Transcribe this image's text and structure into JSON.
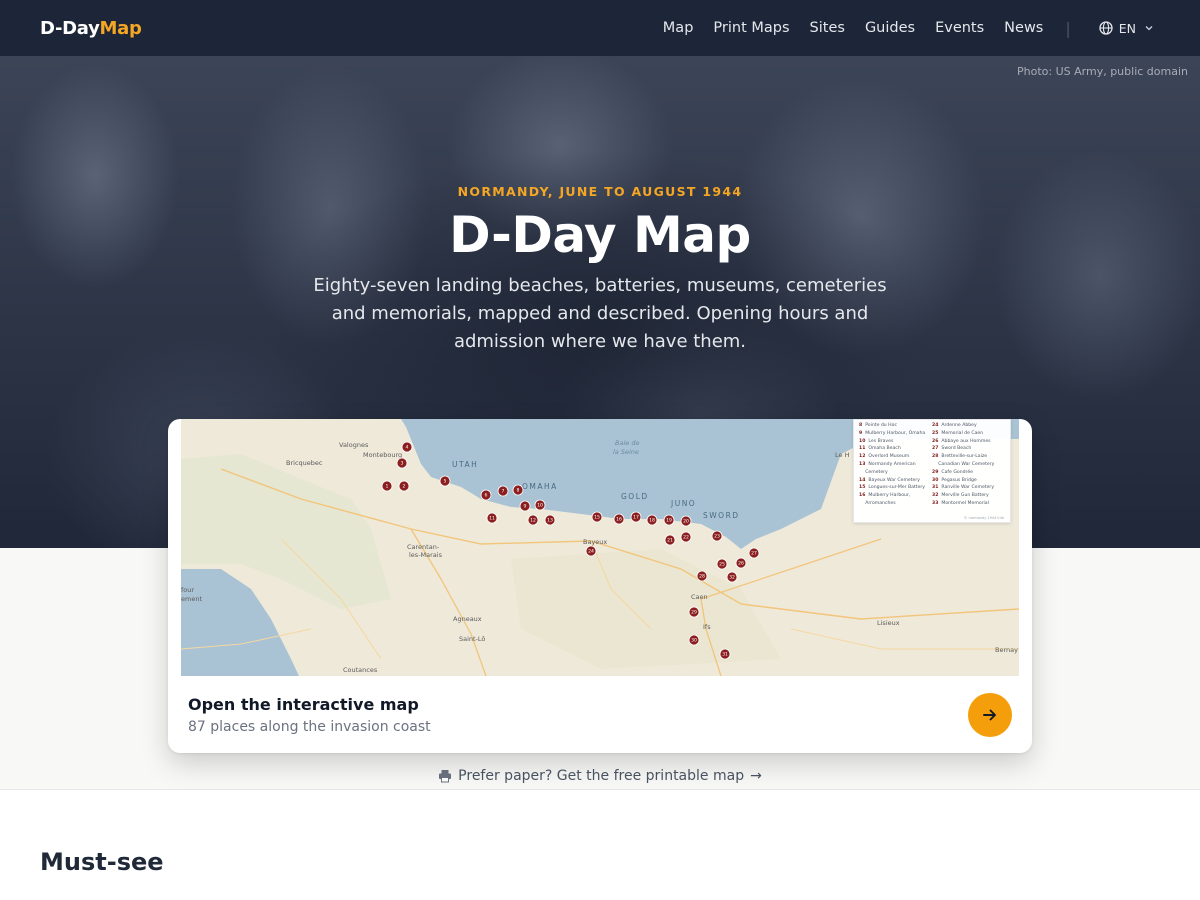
{
  "nav": {
    "logo_part1": "D-Day",
    "logo_part2": "Map",
    "links": [
      "Map",
      "Print Maps",
      "Sites",
      "Guides",
      "Events",
      "News"
    ],
    "separator": "|",
    "lang": "EN",
    "lang_icon": "globe-icon",
    "lang_chevron": "chevron-down-icon"
  },
  "hero": {
    "credit": "Photo: US Army, public domain",
    "eyebrow": "NORMANDY, JUNE TO AUGUST 1944",
    "title": "D-Day Map",
    "subtitle": "Eighty-seven landing beaches, batteries, museums, cemeteries and memorials, mapped and described. Opening hours and admission where we have them."
  },
  "map": {
    "places": [
      "Valognes",
      "Bricquebec",
      "Montebourg",
      "Carentan-les-Marais",
      "Bayeux",
      "Caen",
      "Ifs",
      "Lisieux",
      "Bernay",
      "Agneaux",
      "Saint-Lô",
      "Coutances",
      "Le H",
      "Baie de la Seine"
    ],
    "sea_labels": [
      "UTAH",
      "OMAHA",
      "GOLD",
      "JUNO",
      "SWORD"
    ],
    "markers": [
      "1",
      "2",
      "3",
      "4",
      "5",
      "6",
      "7",
      "8",
      "9",
      "10",
      "11",
      "12",
      "13",
      "15",
      "16",
      "17",
      "18",
      "19",
      "20",
      "21",
      "22",
      "23",
      "24",
      "25",
      "26",
      "27",
      "28",
      "29",
      "30",
      "31",
      "32"
    ],
    "legend_left": [
      {
        "n": "8",
        "name": "Pointe du Hoc"
      },
      {
        "n": "9",
        "name": "Mulberry Harbour, Omaha"
      },
      {
        "n": "10",
        "name": "Les Braves"
      },
      {
        "n": "11",
        "name": "Omaha Beach"
      },
      {
        "n": "12",
        "name": "Overlord Museum"
      },
      {
        "n": "13",
        "name": "Normandy American"
      },
      {
        "n": "",
        "name": "Cemetery"
      },
      {
        "n": "14",
        "name": "Bayeux War Cemetery"
      },
      {
        "n": "15",
        "name": "Longues-sur-Mer Battery"
      },
      {
        "n": "16",
        "name": "Mulberry Harbour,"
      },
      {
        "n": "",
        "name": "Arromanches"
      }
    ],
    "legend_right": [
      {
        "n": "24",
        "name": "Ardenne Abbey"
      },
      {
        "n": "25",
        "name": "Memorial de Caen"
      },
      {
        "n": "26",
        "name": "Abbaye aux Hommes"
      },
      {
        "n": "27",
        "name": "Sword Beach"
      },
      {
        "n": "28",
        "name": "Bretteville-sur-Laize"
      },
      {
        "n": "",
        "name": "Canadian War Cemetery"
      },
      {
        "n": "29",
        "name": "Cafe Gondrée"
      },
      {
        "n": "30",
        "name": "Pegasus Bridge"
      },
      {
        "n": "31",
        "name": "Ranville War Cemetery"
      },
      {
        "n": "32",
        "name": "Merville Gun Battery"
      },
      {
        "n": "33",
        "name": "Montormel Memorial"
      }
    ],
    "legend_footer": "© normandy 1944 info",
    "side_label_1": "four",
    "side_label_2": "ement"
  },
  "card": {
    "title": "Open the interactive map",
    "subtitle": "87 places along the invasion coast",
    "button_icon": "arrow-right-icon"
  },
  "print_link": {
    "icon": "printer-icon",
    "label": "Prefer paper? Get the free printable map",
    "arrow": "→"
  },
  "section": {
    "title": "Must-see"
  },
  "colors": {
    "nav_bg": "#1c2638",
    "accent": "#f5a623",
    "marker": "#8b1e1e",
    "sea": "#a9c3d4",
    "land": "#efe9da"
  }
}
